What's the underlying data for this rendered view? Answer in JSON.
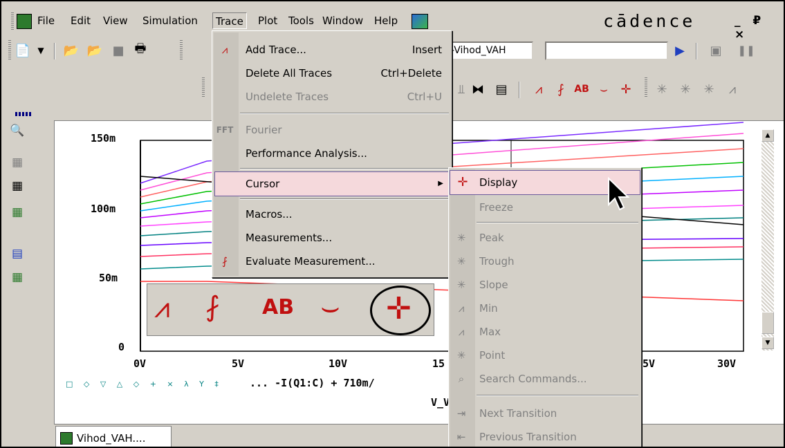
{
  "menubar": {
    "items": [
      {
        "label": "File",
        "u": "F"
      },
      {
        "label": "Edit",
        "u": "E"
      },
      {
        "label": "View",
        "u": "V"
      },
      {
        "label": "Simulation",
        "u": "S"
      },
      {
        "label": "Trace",
        "u": "T"
      },
      {
        "label": "Plot",
        "u": "P"
      },
      {
        "label": "Tools",
        "u": "o"
      },
      {
        "label": "Window",
        "u": "W"
      },
      {
        "label": "Help",
        "u": "H"
      }
    ],
    "brand": "cādence",
    "win_controls": "_ ₽ ×"
  },
  "toolbar": {
    "profile_value": "-Vihod_VAH",
    "profile_input_value": ""
  },
  "trace_menu": [
    {
      "label": "Add Trace...",
      "accel": "Insert",
      "icon": "add-trace-icon",
      "disabled": false
    },
    {
      "label": "Delete All Traces",
      "accel": "Ctrl+Delete",
      "disabled": false
    },
    {
      "label": "Undelete Traces",
      "accel": "Ctrl+U",
      "disabled": true
    },
    {
      "label": "Fourier",
      "icon": "fourier-icon",
      "disabled": true
    },
    {
      "label": "Performance Analysis...",
      "disabled": false
    },
    {
      "label": "Cursor",
      "submenu": true,
      "disabled": false
    },
    {
      "label": "Macros...",
      "disabled": false
    },
    {
      "label": "Measurements...",
      "disabled": false
    },
    {
      "label": "Evaluate Measurement...",
      "icon": "evaluate-measurement-icon",
      "disabled": false
    }
  ],
  "cursor_menu": [
    {
      "label": "Display",
      "disabled": false
    },
    {
      "label": "Freeze",
      "disabled": true
    },
    {
      "label": "Peak",
      "disabled": true
    },
    {
      "label": "Trough",
      "disabled": true
    },
    {
      "label": "Slope",
      "disabled": true
    },
    {
      "label": "Min",
      "disabled": true
    },
    {
      "label": "Max",
      "disabled": true
    },
    {
      "label": "Point",
      "disabled": true
    },
    {
      "label": "Search Commands...",
      "disabled": true
    },
    {
      "label": "Next Transition",
      "disabled": true
    },
    {
      "label": "Previous Transition",
      "disabled": true
    }
  ],
  "plot": {
    "y_ticks": [
      "150m",
      "100m",
      "50m",
      "0"
    ],
    "x_ticks": [
      "0V",
      "5V",
      "10V",
      "15",
      "5V",
      "30V"
    ],
    "legend_text": "... -I(Q1:C)  + 710m/",
    "legend_markers": "□ ◇ ▽ △ ◇ + × λ Y ‡",
    "xaxis_label": "V_V"
  },
  "tab": {
    "label": "Vihod_VAH...."
  },
  "colors": {
    "menu_bg": "#d4d0c8",
    "highlight": "#f5d9dc",
    "highlight_border": "#6b5a9c",
    "window_bg": "#d4d0c8"
  }
}
